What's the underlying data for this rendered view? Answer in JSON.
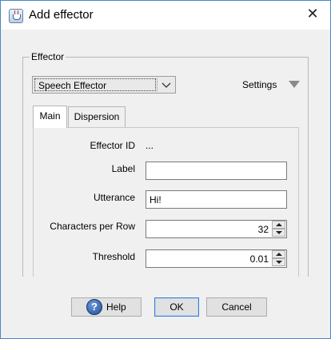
{
  "window": {
    "title": "Add effector",
    "icon": "java-cup-icon",
    "close_glyph": "✕"
  },
  "effector_group": {
    "legend": "Effector",
    "type_selector": {
      "value": "Speech Effector"
    },
    "settings": {
      "label": "Settings",
      "icon": "triangle-down-icon"
    }
  },
  "tabs": [
    {
      "label": "Main",
      "selected": true
    },
    {
      "label": "Dispersion",
      "selected": false
    }
  ],
  "form": {
    "effector_id": {
      "label": "Effector ID",
      "value": "..."
    },
    "label": {
      "label": "Label",
      "value": ""
    },
    "utterance": {
      "label": "Utterance",
      "value": "Hi!"
    },
    "characters_per_row": {
      "label": "Characters per Row",
      "value": "32"
    },
    "threshold": {
      "label": "Threshold",
      "value": "0.01"
    }
  },
  "buttons": {
    "help": {
      "label": "Help",
      "icon": "help-icon",
      "glyph": "?"
    },
    "ok": {
      "label": "OK"
    },
    "cancel": {
      "label": "Cancel"
    }
  },
  "colors": {
    "accent": "#3c7fd0",
    "window_border": "#4a86c8"
  }
}
